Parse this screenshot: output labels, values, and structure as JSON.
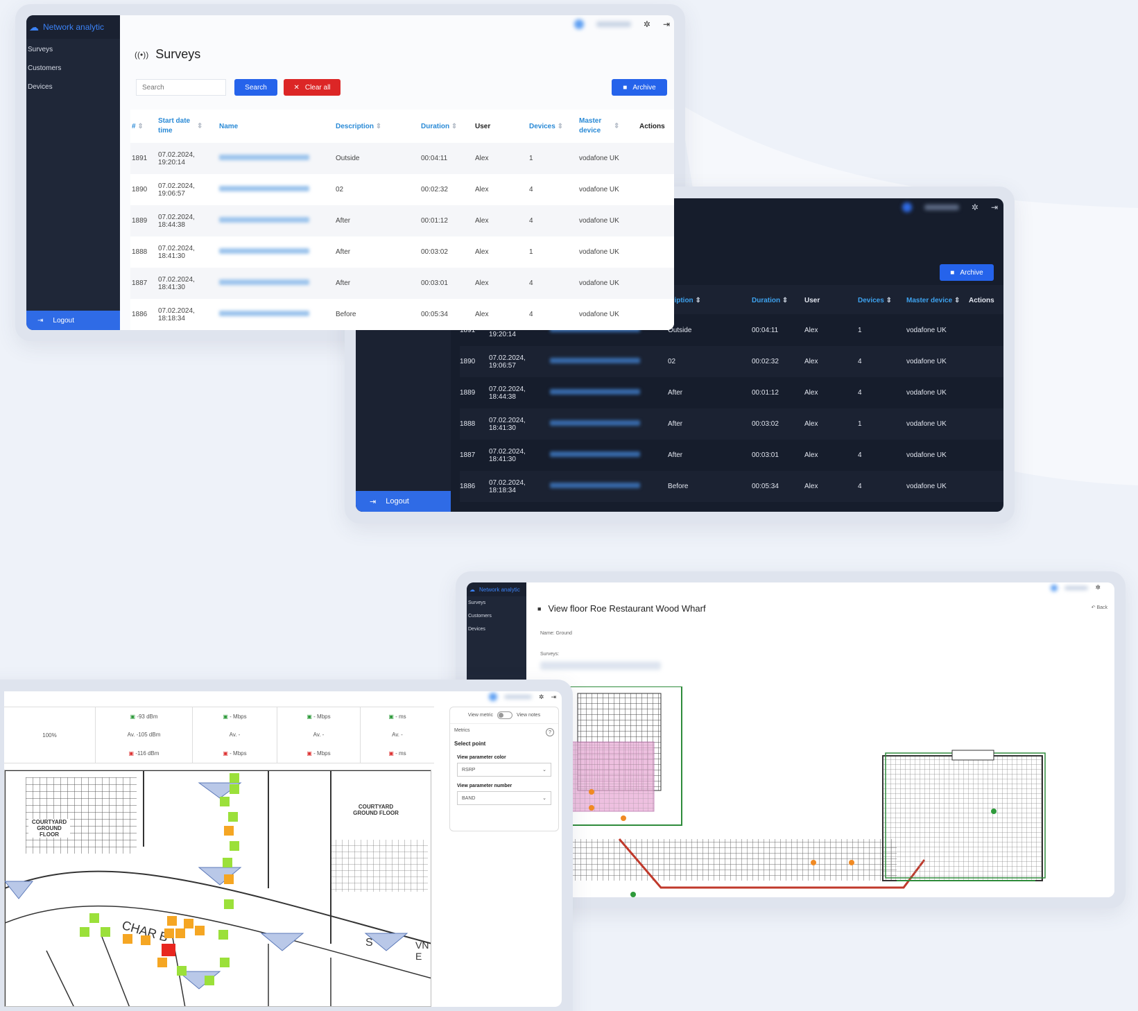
{
  "app": {
    "brand": "Network analytic",
    "nav": [
      "Surveys",
      "Customers",
      "Devices"
    ],
    "logout": "Logout"
  },
  "surveys": {
    "title": "Surveys",
    "search_placeholder": "Search",
    "search_button": "Search",
    "clear_button": "Clear all",
    "archive_button": "Archive",
    "columns": {
      "num": "#",
      "start": "Start date time",
      "name": "Name",
      "description": "Description",
      "duration": "Duration",
      "user": "User",
      "devices": "Devices",
      "master": "Master device",
      "actions": "Actions"
    },
    "rows": [
      {
        "id": "1891",
        "date": "07.02.2024,",
        "time": "19:20:14",
        "description": "Outside",
        "duration": "00:04:11",
        "user": "Alex",
        "devices": "1",
        "master": "vodafone UK"
      },
      {
        "id": "1890",
        "date": "07.02.2024,",
        "time": "19:06:57",
        "description": "02",
        "duration": "00:02:32",
        "user": "Alex",
        "devices": "4",
        "master": "vodafone UK"
      },
      {
        "id": "1889",
        "date": "07.02.2024,",
        "time": "18:44:38",
        "description": "After",
        "duration": "00:01:12",
        "user": "Alex",
        "devices": "4",
        "master": "vodafone UK"
      },
      {
        "id": "1888",
        "date": "07.02.2024,",
        "time": "18:41:30",
        "description": "After",
        "duration": "00:03:02",
        "user": "Alex",
        "devices": "1",
        "master": "vodafone UK"
      },
      {
        "id": "1887",
        "date": "07.02.2024,",
        "time": "18:41:30",
        "description": "After",
        "duration": "00:03:01",
        "user": "Alex",
        "devices": "4",
        "master": "vodafone UK"
      },
      {
        "id": "1886",
        "date": "07.02.2024,",
        "time": "18:18:34",
        "description": "Before",
        "duration": "00:05:34",
        "user": "Alex",
        "devices": "4",
        "master": "vodafone UK"
      }
    ],
    "dark_partial_description_header": "cription"
  },
  "floor": {
    "title": "View floor Roe Restaurant Wood Wharf",
    "back": "Back",
    "name_label": "Name: Ground",
    "surveys_label": "Surveys:"
  },
  "metrics": {
    "coverage": "100%",
    "rsrp_top": "-93 dBm",
    "rsrp_avg": "Av. -105 dBm",
    "rsrp_bottom": "-116 dBm",
    "dl_top": "- Mbps",
    "dl_avg": "Av. -",
    "dl_bottom": "- Mbps",
    "ul_top": "- Mbps",
    "ul_avg": "Av. -",
    "ul_bottom": "- Mbps",
    "lat_top": "- ms",
    "lat_avg": "Av. -",
    "lat_bottom": "- ms",
    "panel": {
      "view_metric": "View metric",
      "view_notes": "View notes",
      "metrics": "Metrics",
      "select_point": "Select point",
      "color_label": "View parameter color",
      "color_value": "RSRP",
      "number_label": "View parameter number",
      "number_value": "BAND"
    },
    "plan_labels": [
      "COURTYARD GROUND FLOOR",
      "COURTYARD GROUND FLOOR",
      "CHAR B",
      "S",
      "VN E"
    ]
  },
  "colors": {
    "sidebar": "#1f2738",
    "accent": "#2563eb",
    "danger": "#dc2626",
    "dark_bg": "#161d2c",
    "header_link": "#2a8ad6",
    "tile_green": "#9be03a",
    "tile_orange": "#f5a623",
    "tile_red": "#e8261f",
    "pink_zone": "#e7a6d3"
  }
}
